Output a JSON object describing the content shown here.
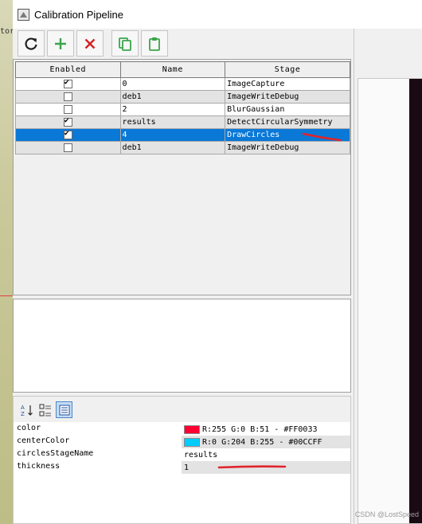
{
  "window": {
    "title": "Calibration Pipeline"
  },
  "background": {
    "left_text": "tor"
  },
  "toolbar": {
    "buttons": [
      {
        "name": "refresh-icon",
        "color": "#222222"
      },
      {
        "name": "add-icon",
        "color": "#3aa64a"
      },
      {
        "name": "remove-icon",
        "color": "#d62020"
      },
      {
        "name": "copy-icon",
        "color": "#3aa64a"
      },
      {
        "name": "paste-icon",
        "color": "#3aa64a"
      }
    ]
  },
  "table": {
    "headers": [
      "Enabled",
      "Name",
      "Stage"
    ],
    "rows": [
      {
        "enabled": true,
        "name": "0",
        "stage": "ImageCapture"
      },
      {
        "enabled": false,
        "name": "deb1",
        "stage": "ImageWriteDebug"
      },
      {
        "enabled": false,
        "name": "2",
        "stage": "BlurGaussian"
      },
      {
        "enabled": true,
        "name": "results",
        "stage": "DetectCircularSymmetry"
      },
      {
        "enabled": true,
        "name": "4",
        "stage": "DrawCircles",
        "selected": true
      },
      {
        "enabled": false,
        "name": "deb1",
        "stage": "ImageWriteDebug"
      }
    ],
    "selection_color": "#0a78d7"
  },
  "properties": {
    "toolbar": [
      {
        "name": "sort-alpha-icon"
      },
      {
        "name": "categorized-icon"
      },
      {
        "name": "property-pages-icon",
        "active": true
      }
    ],
    "items": [
      {
        "name": "color",
        "value": "R:255 G:0 B:51 - #FF0033",
        "swatch": "#FF0033"
      },
      {
        "name": "centerColor",
        "value": "R:0 G:204 B:255 - #00CCFF",
        "swatch": "#00CCFF"
      },
      {
        "name": "circlesStageName",
        "value": "results"
      },
      {
        "name": "thickness",
        "value": "1"
      }
    ]
  },
  "annotation_color": "#e0242c",
  "watermark": "CSDN @LostSpeed"
}
